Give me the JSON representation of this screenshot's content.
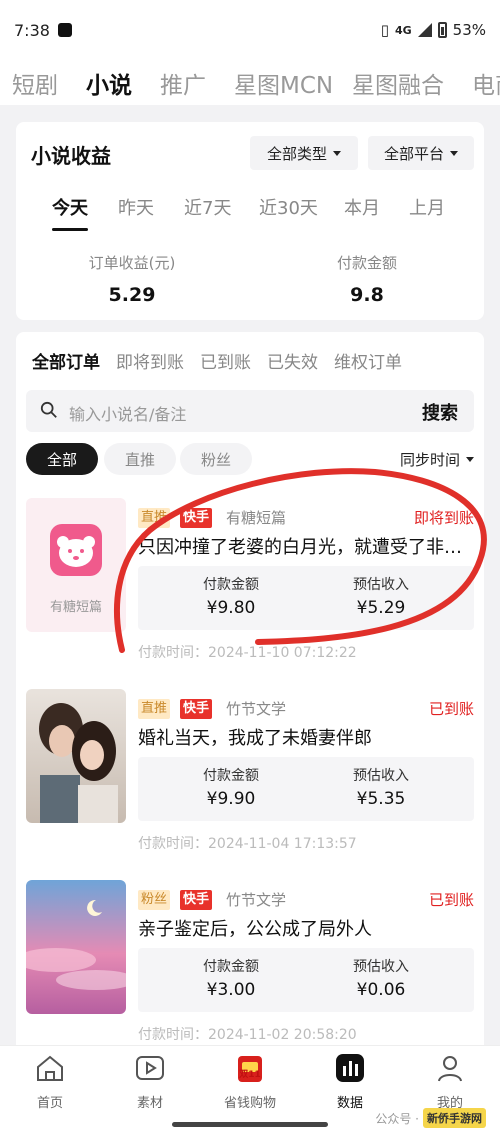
{
  "status_bar": {
    "time": "7:38",
    "network": "4G",
    "battery": "53%"
  },
  "top_nav": {
    "items": [
      "短剧",
      "小说",
      "推广",
      "星图MCN",
      "星图融合",
      "电商"
    ],
    "active": 1
  },
  "summary": {
    "title": "小说收益",
    "type_filter": "全部类型",
    "platform_filter": "全部平台",
    "date_tabs": [
      "今天",
      "昨天",
      "近7天",
      "近30天",
      "本月",
      "上月"
    ],
    "active_date_tab": 0,
    "order_income_label": "订单收益(元)",
    "order_income_value": "5.29",
    "payment_label": "付款金额",
    "payment_value": "9.8"
  },
  "orders_section": {
    "tabs": [
      "全部订单",
      "即将到账",
      "已到账",
      "已失效",
      "维权订单"
    ],
    "search_placeholder": "输入小说名/备注",
    "search_button": "搜索",
    "filter_pills": [
      "全部",
      "直推",
      "粉丝"
    ],
    "sort_label": "同步时间",
    "orders": [
      {
        "cover_label": "有糖短篇",
        "tag1": "直推",
        "tag2": "快手",
        "author": "有糖短篇",
        "status": "即将到账",
        "title": "只因冲撞了老婆的白月光，就遭受了非…",
        "pay_label": "付款金额",
        "pay_value": "¥9.80",
        "income_label": "预估收入",
        "income_value": "¥5.29",
        "time": "付款时间：2024-11-10 07:12:22"
      },
      {
        "tag1": "直推",
        "tag2": "快手",
        "author": "竹节文学",
        "status": "已到账",
        "title": "婚礼当天，我成了未婚妻伴郎",
        "pay_label": "付款金额",
        "pay_value": "¥9.90",
        "income_label": "预估收入",
        "income_value": "¥5.35",
        "time": "付款时间：2024-11-04 17:13:57"
      },
      {
        "tag1": "粉丝",
        "tag2": "快手",
        "author": "竹节文学",
        "status": "已到账",
        "title": "亲子鉴定后，公公成了局外人",
        "pay_label": "付款金额",
        "pay_value": "¥3.00",
        "income_label": "预估收入",
        "income_value": "¥0.06",
        "time": "付款时间：2024-11-02 20:58:20"
      }
    ]
  },
  "bottom_nav": {
    "items": [
      "首页",
      "素材",
      "省钱购物",
      "数据",
      "我的"
    ],
    "active": 3,
    "badge": "双11"
  },
  "watermark": {
    "text": "公众号 ·",
    "logo": "新侨手游网"
  },
  "colors": {
    "accent_red": "#e02020",
    "annotation_red": "#e0302a"
  }
}
